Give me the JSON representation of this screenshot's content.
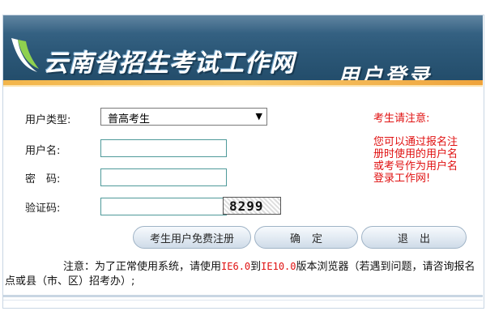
{
  "header": {
    "site_title": "云南省招生考试工作网",
    "login_title": "用户登录"
  },
  "form": {
    "user_type_label": "用户类型:",
    "user_type_value": "普高考生",
    "username_label": "用户名:",
    "username_value": "",
    "password_label": "密　码:",
    "password_value": "",
    "captcha_label": "验证码:",
    "captcha_value": "",
    "captcha_image_text": "8299"
  },
  "notice": {
    "title": "考生请注意:",
    "body": "您可以通过报名注册时使用的用户名或考号作为用户名登录工作网!"
  },
  "buttons": {
    "register": "考生用户免费注册",
    "confirm": "确定",
    "exit": "退出"
  },
  "footnote": {
    "prefix": "注意：为了正常使用系统，请使用",
    "ie6": "IE6.0",
    "to": "到",
    "ie10": "IE10.0",
    "suffix": "版本浏览器（若遇到问题，请咨询报名点或县（市、区）招考办）;"
  },
  "colors": {
    "banner": "#2c5878",
    "accent_orange": "#f3b54a",
    "notice_red": "#e01010"
  }
}
